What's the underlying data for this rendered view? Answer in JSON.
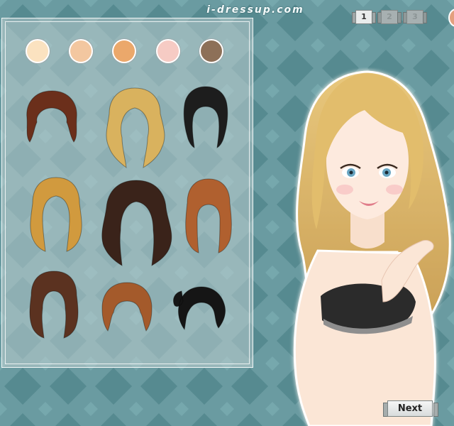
{
  "site": {
    "title": "i-dressup.com"
  },
  "pager": {
    "pages": [
      {
        "label": "1",
        "active": true
      },
      {
        "label": "2",
        "active": false
      },
      {
        "label": "3",
        "active": false
      }
    ]
  },
  "skin_tones": [
    "#fbe2c0",
    "#f3c7a0",
    "#eba86b",
    "#f6cbc4",
    "#8d7058"
  ],
  "hairstyles": [
    {
      "name": "short-auburn",
      "color": "#6b2f1b"
    },
    {
      "name": "long-blonde-wavy",
      "color": "#d9b25e"
    },
    {
      "name": "black-updo",
      "color": "#1d1d1d"
    },
    {
      "name": "golden-long",
      "color": "#d19a3e"
    },
    {
      "name": "dark-brown-long",
      "color": "#3a231a"
    },
    {
      "name": "auburn-bangs",
      "color": "#b0602f"
    },
    {
      "name": "brown-wavy",
      "color": "#5b3220"
    },
    {
      "name": "copper-bob",
      "color": "#a45a2b"
    },
    {
      "name": "black-ponytail",
      "color": "#151515"
    }
  ],
  "buttons": {
    "next": "Next"
  },
  "colors": {
    "background": "#5f9096",
    "diamond": "#4f7f86",
    "panel_border": "#f2f7f7"
  }
}
